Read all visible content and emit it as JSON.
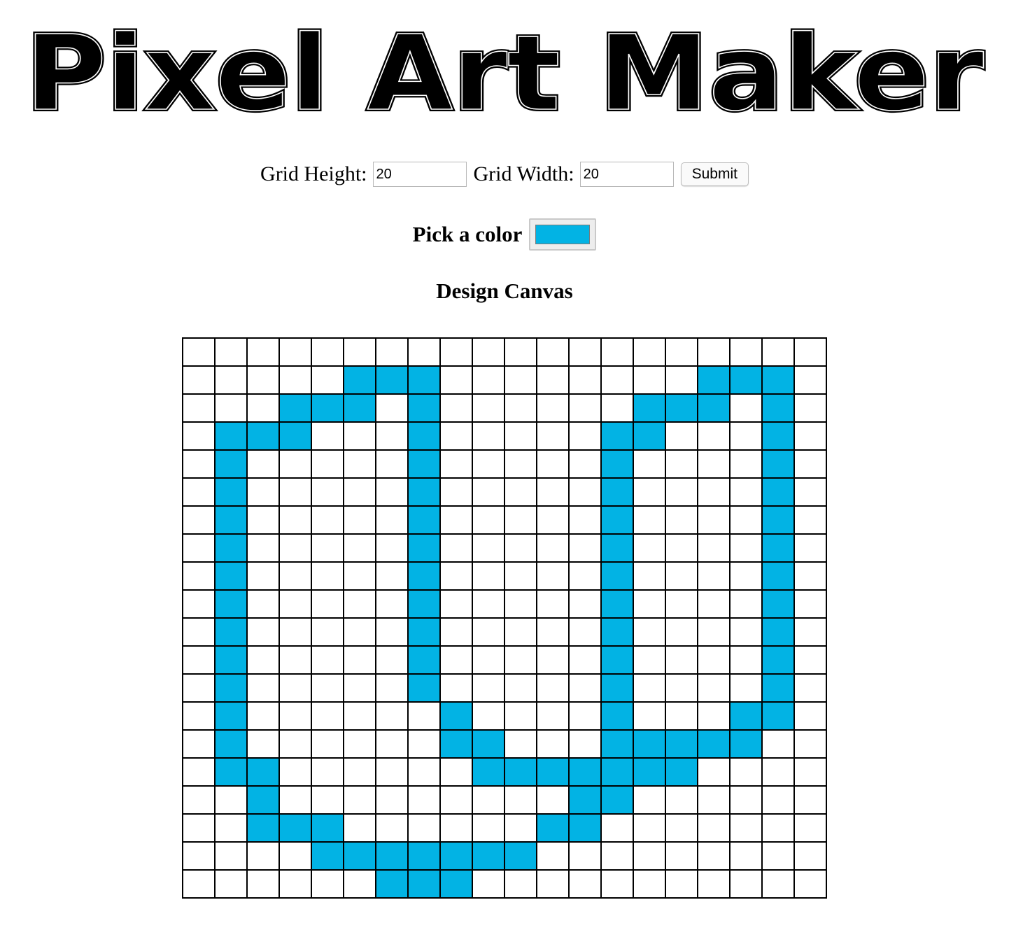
{
  "title": "Pixel Art Maker",
  "form": {
    "height_label": "Grid Height:",
    "height_value": "20",
    "width_label": "Grid Width:",
    "width_value": "20",
    "submit_label": "Submit"
  },
  "color_picker": {
    "label": "Pick a color",
    "value": "#02b3e4"
  },
  "canvas": {
    "heading": "Design Canvas",
    "rows": 20,
    "cols": 20,
    "empty_color": "#ffffff",
    "fill_color": "#02b3e4",
    "filled_cells": [
      [
        1,
        5
      ],
      [
        1,
        6
      ],
      [
        1,
        7
      ],
      [
        1,
        16
      ],
      [
        1,
        17
      ],
      [
        1,
        18
      ],
      [
        2,
        3
      ],
      [
        2,
        4
      ],
      [
        2,
        5
      ],
      [
        2,
        7
      ],
      [
        2,
        14
      ],
      [
        2,
        15
      ],
      [
        2,
        16
      ],
      [
        2,
        18
      ],
      [
        3,
        1
      ],
      [
        3,
        2
      ],
      [
        3,
        3
      ],
      [
        3,
        7
      ],
      [
        3,
        13
      ],
      [
        3,
        14
      ],
      [
        3,
        18
      ],
      [
        4,
        1
      ],
      [
        4,
        7
      ],
      [
        4,
        13
      ],
      [
        4,
        18
      ],
      [
        5,
        1
      ],
      [
        5,
        7
      ],
      [
        5,
        13
      ],
      [
        5,
        18
      ],
      [
        6,
        1
      ],
      [
        6,
        7
      ],
      [
        6,
        13
      ],
      [
        6,
        18
      ],
      [
        7,
        1
      ],
      [
        7,
        7
      ],
      [
        7,
        13
      ],
      [
        7,
        18
      ],
      [
        8,
        1
      ],
      [
        8,
        7
      ],
      [
        8,
        13
      ],
      [
        8,
        18
      ],
      [
        9,
        1
      ],
      [
        9,
        7
      ],
      [
        9,
        13
      ],
      [
        9,
        18
      ],
      [
        10,
        1
      ],
      [
        10,
        7
      ],
      [
        10,
        13
      ],
      [
        10,
        18
      ],
      [
        11,
        1
      ],
      [
        11,
        7
      ],
      [
        11,
        13
      ],
      [
        11,
        18
      ],
      [
        12,
        1
      ],
      [
        12,
        7
      ],
      [
        12,
        13
      ],
      [
        12,
        18
      ],
      [
        13,
        1
      ],
      [
        13,
        8
      ],
      [
        13,
        13
      ],
      [
        13,
        17
      ],
      [
        13,
        18
      ],
      [
        14,
        1
      ],
      [
        14,
        8
      ],
      [
        14,
        9
      ],
      [
        14,
        13
      ],
      [
        14,
        14
      ],
      [
        14,
        15
      ],
      [
        14,
        16
      ],
      [
        14,
        17
      ],
      [
        15,
        1
      ],
      [
        15,
        2
      ],
      [
        15,
        9
      ],
      [
        15,
        10
      ],
      [
        15,
        11
      ],
      [
        15,
        12
      ],
      [
        15,
        13
      ],
      [
        15,
        14
      ],
      [
        15,
        15
      ],
      [
        16,
        2
      ],
      [
        16,
        12
      ],
      [
        16,
        13
      ],
      [
        17,
        2
      ],
      [
        17,
        3
      ],
      [
        17,
        4
      ],
      [
        17,
        11
      ],
      [
        17,
        12
      ],
      [
        18,
        4
      ],
      [
        18,
        5
      ],
      [
        18,
        6
      ],
      [
        18,
        7
      ],
      [
        18,
        8
      ],
      [
        18,
        9
      ],
      [
        18,
        10
      ],
      [
        19,
        6
      ],
      [
        19,
        7
      ],
      [
        19,
        8
      ]
    ]
  }
}
